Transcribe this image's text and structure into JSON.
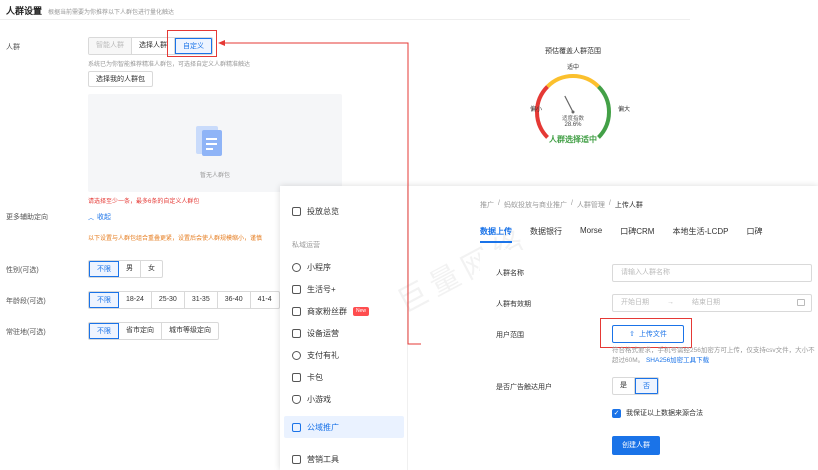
{
  "header": {
    "title": "人群设置",
    "subtitle": "根据当前需要为你推荐以下人群包进行量化触达"
  },
  "crowd": {
    "label": "人群",
    "options": [
      "智能人群",
      "选择人群",
      "自定义"
    ],
    "hint": "系统已为你智能推荐精准人群包，可选择自定义人群精准触达",
    "select_button": "选择我的人群包",
    "empty_text": "暂无人群包",
    "error_text": "请选择至少一条，最多6条的自定义人群包"
  },
  "more": {
    "label": "更多辅助定向",
    "toggle": "收起",
    "warning": "以下设置与人群包组合重叠更紧，设置后会使人群规模缩小，谨慎"
  },
  "gender": {
    "label": "性别(可选)",
    "options": [
      "不限",
      "男",
      "女"
    ]
  },
  "age": {
    "label": "年龄段(可选)",
    "options": [
      "不限",
      "18-24",
      "25-30",
      "31-35",
      "36-40",
      "41-4"
    ]
  },
  "region": {
    "label": "常驻地(可选)",
    "options": [
      "不限",
      "省市定向",
      "城市等级定向"
    ]
  },
  "gauge": {
    "title": "预估覆盖人群范围",
    "mid_label": "适中",
    "low_label": "偏小",
    "high_label": "偏大",
    "value_label": "适度指数",
    "value": "28.6%",
    "status": "人群选择适中",
    "pointer_fraction": 0.4,
    "colors": [
      "#e53935",
      "#fbc02d",
      "#43a047"
    ]
  },
  "overlay": {
    "watermark": "巨量网络",
    "nav": {
      "top_item": "投放总览",
      "section": "私域运营",
      "items": [
        "小程序",
        "生活号+",
        "商家粉丝群",
        "设备运营",
        "支付有礼",
        "卡包",
        "小游戏",
        "公域推广",
        "营销工具"
      ],
      "new_badge": "New",
      "active_index": 7
    },
    "breadcrumb": [
      "推广",
      "蚂蚁投放与商业推广",
      "人群管理",
      "上传人群"
    ],
    "tabs": [
      "数据上传",
      "数据银行",
      "Morse",
      "口碑CRM",
      "本地生活-LCDP",
      "口碑"
    ],
    "active_tab": 0,
    "form": {
      "name_label": "人群名称",
      "name_placeholder": "请输入人群名称",
      "validity_label": "人群有效期",
      "start_placeholder": "开始日期",
      "range_sep": "→",
      "end_placeholder": "结束日期",
      "scope_label": "用户范围",
      "upload_button": "上传文件",
      "upload_hint": "符合格式要求，手机号需经256加密方可上传，仅支持csv文件，大小不超过60M。",
      "upload_link": "SHA256加密工具下载",
      "ad_label": "是否广告触达用户",
      "ad_options": [
        "是",
        "否"
      ],
      "agree_text": "我保证以上数据来源合法",
      "create_button": "创建人群"
    }
  }
}
